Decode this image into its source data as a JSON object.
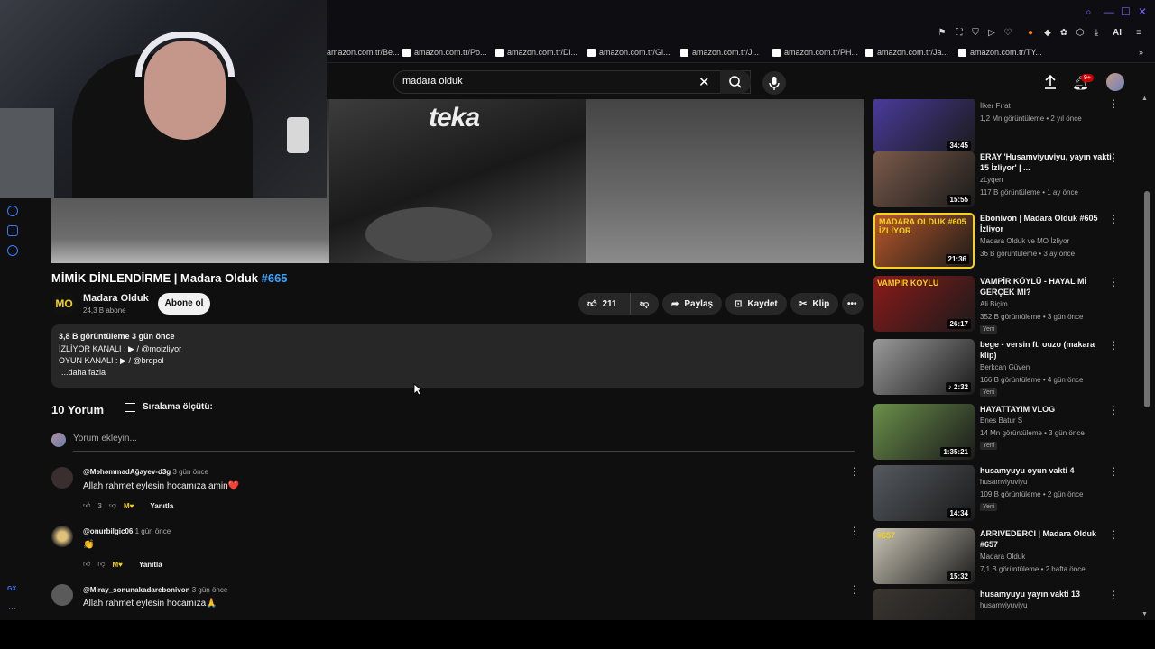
{
  "bookmarks": [
    "amazon.com.tr/Be...",
    "amazon.com.tr/Po...",
    "amazon.com.tr/Di...",
    "amazon.com.tr/Gi...",
    "amazon.com.tr/J...",
    "amazon.com.tr/PH...",
    "amazon.com.tr/Ja...",
    "amazon.com.tr/TY..."
  ],
  "toolbar": {
    "ai_label": "AI"
  },
  "search": {
    "query": "madara olduk"
  },
  "header": {
    "notif_badge": "9+"
  },
  "video": {
    "title": "MİMİK DİNLENDİRME | Madara Olduk ",
    "title_tag": "#665",
    "shirt_text": "teka"
  },
  "channel": {
    "avatar_text": "MO",
    "name": "Madara Olduk",
    "subs": "24,3 B abone",
    "subscribe_label": "Abone ol"
  },
  "actions": {
    "likes": "211",
    "share": "Paylaş",
    "save": "Kaydet",
    "clip": "Klip"
  },
  "description": {
    "views_line": "3,8 B görüntüleme  3 gün önce",
    "line1": "İZLİYOR KANALI :  ▶  / @moizliyor",
    "line2": "OYUN KANALI :  ▶  / @brqpol",
    "more": "...daha fazla"
  },
  "comments": {
    "count_label": "10 Yorum",
    "sort_label": "Sıralama ölçütü:",
    "add_placeholder": "Yorum ekleyin...",
    "reply_label": "Yanıtla",
    "items": [
      {
        "author": "@MəhəmmədAğayev-d3g",
        "time": "3 gün önce",
        "text": "Allah rahmet eylesin hocamıza amin❤️",
        "likes": "3"
      },
      {
        "author": "@onurbilgic06",
        "time": "1 gün önce",
        "text": "👏",
        "likes": ""
      },
      {
        "author": "@Miray_sonunakadarebonivon",
        "time": "3 gün önce",
        "text": "Allah rahmet eylesin hocamıza🙏",
        "likes": ""
      }
    ]
  },
  "recommendations": [
    {
      "title": "",
      "channel": "İlker Fırat",
      "meta": "1,2 Mn görüntüleme • 2 yıl önce",
      "duration": "34:45",
      "new": "",
      "color": "#4a3b9c"
    },
    {
      "title": "ERAY 'Husamviyuviyu, yayın vakti 15 İzliyor' | ...",
      "channel": "zLyqen",
      "meta": "117 B görüntüleme • 1 ay önce",
      "duration": "15:55",
      "new": "",
      "color": "#7a5a4a"
    },
    {
      "title": "Ebonivon | Madara Olduk #605 İzliyor",
      "channel": "Madara Olduk ve MO İzliyor",
      "meta": "36 B görüntüleme • 3 ay önce",
      "duration": "21:36",
      "new": "",
      "color": "#b8582a",
      "thumb_text": "MADARA OLDUK #605 İZLİYOR"
    },
    {
      "title": "VAMPİR KÖYLÜ - HAYAL Mİ GERÇEK Mİ?",
      "channel": "Ali Biçim",
      "meta": "352 B görüntüleme • 3 gün önce",
      "duration": "26:17",
      "new": "Yeni",
      "color": "#8b1a1a",
      "thumb_text": "VAMPİR KÖYLÜ"
    },
    {
      "title": "bege - versin ft. ouzo (makara klip)",
      "channel": "Berkcan Güven",
      "meta": "166 B görüntüleme • 4 gün önce",
      "duration": "♪ 2:32",
      "new": "Yeni",
      "color": "#9a9a9a"
    },
    {
      "title": "HAYATTAYIM VLOG",
      "channel": "Enes Batur S",
      "meta": "14 Mn görüntüleme • 3 gün önce",
      "duration": "1:35:21",
      "new": "Yeni",
      "color": "#6a8f4a"
    },
    {
      "title": "husamyuyu oyun vakti 4",
      "channel": "husamviyuviyu",
      "meta": "109 B görüntüleme • 2 gün önce",
      "duration": "14:34",
      "new": "Yeni",
      "color": "#555a60"
    },
    {
      "title": "ARRIVEDERCI | Madara Olduk #657",
      "channel": "Madara Olduk",
      "meta": "7,1 B görüntüleme • 2 hafta önce",
      "duration": "15:32",
      "new": "",
      "color": "#c9c4b5",
      "thumb_text": "#657"
    },
    {
      "title": "husamyuyu yayın vakti 13",
      "channel": "husamviyuviyu",
      "meta": "",
      "duration": "",
      "new": "",
      "color": "#3a3530"
    }
  ],
  "rail": {
    "gx_label": "GX"
  }
}
